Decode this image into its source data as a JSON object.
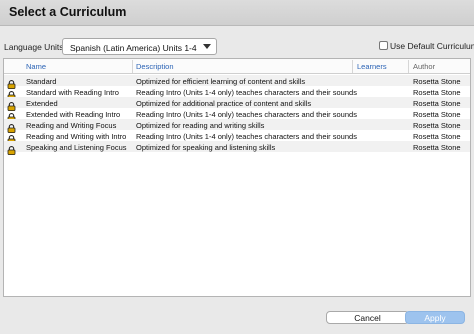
{
  "dialog": {
    "title": "Select a Curriculum"
  },
  "language": {
    "label": "Language Units:",
    "selected": "Spanish (Latin America) Units 1-4"
  },
  "default_curriculum": {
    "label": "Use Default Curriculum",
    "checked": false
  },
  "table": {
    "headers": [
      "Name",
      "Description",
      "Learners",
      "Author"
    ],
    "rows": [
      {
        "name": "Standard",
        "description": "Optimized for efficient learning of content and skills",
        "learners": "",
        "author": "Rosetta Stone",
        "locked": true
      },
      {
        "name": "Standard with Reading Intro",
        "description": "Reading Intro (Units 1-4 only) teaches characters and their sounds",
        "learners": "",
        "author": "Rosetta Stone",
        "locked": true
      },
      {
        "name": "Extended",
        "description": "Optimized for additional practice of content and skills",
        "learners": "",
        "author": "Rosetta Stone",
        "locked": true
      },
      {
        "name": "Extended with Reading Intro",
        "description": "Reading Intro (Units 1-4 only) teaches characters and their sounds",
        "learners": "",
        "author": "Rosetta Stone",
        "locked": true
      },
      {
        "name": "Reading and Writing Focus",
        "description": "Optimized for reading and writing skills",
        "learners": "",
        "author": "Rosetta Stone",
        "locked": true
      },
      {
        "name": "Reading and Writing with Intro",
        "description": "Reading Intro (Units 1-4 only) teaches characters and their sounds",
        "learners": "",
        "author": "Rosetta Stone",
        "locked": true
      },
      {
        "name": "Speaking and Listening Focus",
        "description": "Optimized for speaking and listening skills",
        "learners": "",
        "author": "Rosetta Stone",
        "locked": true
      }
    ]
  },
  "buttons": {
    "cancel": "Cancel",
    "apply": "Apply"
  },
  "colors": {
    "header_link": "#2b63b5",
    "apply_bg": "#9dc3ee",
    "row_alt": "#f1f1f1"
  },
  "icons": {
    "row_lock": "lock-icon",
    "select_arrow": "chevron-down-icon"
  }
}
